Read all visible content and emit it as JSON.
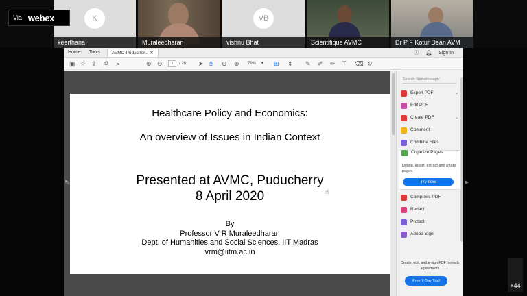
{
  "meeting": {
    "brand_via": "Via",
    "brand_name": "webex",
    "participants": [
      {
        "name": "keerthana",
        "initial": "K"
      },
      {
        "name": "Muraleedharan",
        "initial": ""
      },
      {
        "name": "vishnu Bhat",
        "initial": "VB"
      },
      {
        "name": "Scientifique AVMC",
        "initial": ""
      },
      {
        "name": "Dr P F Kotur Dean AVM",
        "initial": ""
      }
    ],
    "more_count": "+44"
  },
  "acrobat": {
    "menu": [
      "Home",
      "Tools"
    ],
    "doc_tab": "AVMC-Puducher...",
    "sign_in": "Sign In",
    "page_current": "1",
    "page_total": "/ 26",
    "zoom": "79%",
    "panel": {
      "search_placeholder": "Search 'Strikethrough'",
      "items": [
        {
          "label": "Export PDF",
          "icon_color": "#e03c3c"
        },
        {
          "label": "Edit PDF",
          "icon_color": "#c54ea7"
        },
        {
          "label": "Create PDF",
          "icon_color": "#e03c3c"
        },
        {
          "label": "Comment",
          "icon_color": "#f2b318"
        },
        {
          "label": "Combine Files",
          "icon_color": "#7a5fd6"
        },
        {
          "label": "Organize Pages",
          "icon_color": "#4fa84a"
        }
      ],
      "organize_desc": "Delete, insert, extract and rotate pages.",
      "try_now": "Try now",
      "items2": [
        {
          "label": "Compress PDF",
          "icon_color": "#e03c3c"
        },
        {
          "label": "Redact",
          "icon_color": "#d8427a"
        },
        {
          "label": "Protect",
          "icon_color": "#7a5fd6"
        },
        {
          "label": "Adobe Sign",
          "icon_color": "#8a5cd0"
        }
      ],
      "footer_text": "Create, edit, and e-sign PDF forms & agreements",
      "trial_button": "Free 7-Day Trial"
    }
  },
  "slide": {
    "title": "Healthcare Policy and Economics:",
    "subtitle": "An overview of Issues in Indian Context",
    "presented": "Presented at AVMC, Puducherry",
    "date": "8 April 2020",
    "by": "By",
    "author": "Professor V R Muraleedharan",
    "dept": "Dept. of Humanities and Social Sciences, IIT Madras",
    "email": "vrm@iitm.ac.in"
  }
}
